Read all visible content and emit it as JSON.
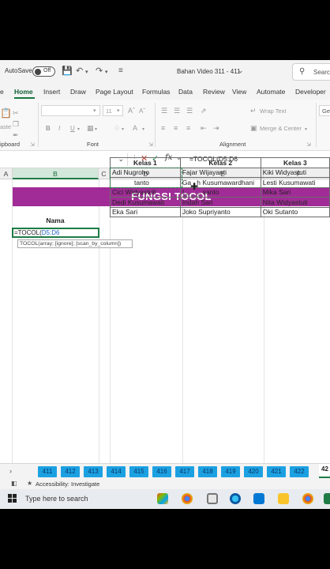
{
  "titlebar": {
    "autosave_label": "AutoSave",
    "autosave_state": "Off",
    "file_title": "Bahan Video 311 - 411",
    "search_placeholder": "Searc"
  },
  "ribbon_tabs": [
    "e",
    "Home",
    "Insert",
    "Draw",
    "Page Layout",
    "Formulas",
    "Data",
    "Review",
    "View",
    "Automate",
    "Developer"
  ],
  "ribbon": {
    "font_size": "11",
    "paste_label": "aste",
    "clipboard_label": "ipboard",
    "font_group_label": "Font",
    "alignment_group_label": "Alignment",
    "wrap_text": "Wrap Text",
    "merge_center": "Merge & Center",
    "bold": "B",
    "italic": "I",
    "underline": "U",
    "right_tab": "Ge"
  },
  "formula_bar": {
    "fx": "fx",
    "formula": "=TOCOL(D5:D6"
  },
  "columns": [
    "A",
    "B",
    "C",
    "D",
    "E",
    "F"
  ],
  "sheet": {
    "banner": "FUNGSI TOCOL",
    "nama_header": "Nama",
    "active_cell_prefix": "=TOCOL(",
    "active_cell_ref": "D5:D6",
    "tooltip": "TOCOL(array; [ignore]; [scan_by_column])",
    "drag_label": "2R x 1C",
    "table": {
      "headers": [
        "Kelas 1",
        "Kelas 2",
        "Kelas 3"
      ],
      "rows": [
        [
          "Adi Nugroho",
          "Fajar Wijayanti",
          "Kiki Widyastuti"
        ],
        [
          "tanto",
          "Ga   h Kusumawardhani",
          "Lesti Kusumawati"
        ],
        [
          "Cici Widyastuti",
          "I          santo",
          "Mika Sari"
        ],
        [
          "Dedi Kusumawati",
          "Indah Sari",
          "Nita Widyastuti"
        ],
        [
          "Eka Sari",
          "Joko Supriyanto",
          "Oki Sutanto"
        ]
      ]
    }
  },
  "sheet_tabs": [
    "411",
    "412",
    "413",
    "414",
    "415",
    "416",
    "417",
    "418",
    "419",
    "420",
    "421",
    "422"
  ],
  "active_sheet_tab": "42",
  "status": {
    "accessibility": "Accessibility: Investigate"
  },
  "taskbar": {
    "search_placeholder": "Type here to search"
  },
  "colors": {
    "banner": "#a12c97",
    "excel_green": "#1e7b45",
    "sheet_tab": "#1ba1e2"
  }
}
